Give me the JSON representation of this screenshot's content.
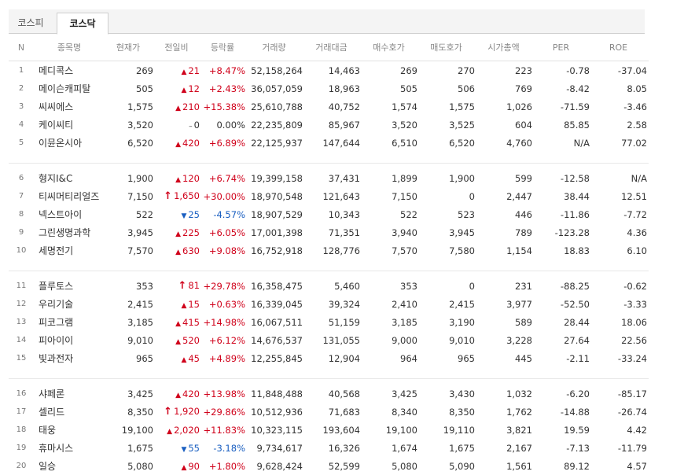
{
  "tabs": [
    {
      "label": "코스피"
    },
    {
      "label": "코스닥"
    }
  ],
  "columns": [
    "N",
    "종목명",
    "현재가",
    "전일비",
    "등락률",
    "거래량",
    "거래대금",
    "매수호가",
    "매도호가",
    "시가총액",
    "PER",
    "ROE"
  ],
  "groups": [
    [
      {
        "n": "1",
        "name": "메디콕스",
        "price": "269",
        "dir": "up",
        "change": "21",
        "rate": "+8.47%",
        "volume": "52,158,264",
        "amount": "14,463",
        "bid": "269",
        "ask": "270",
        "cap": "223",
        "per": "-0.78",
        "roe": "-37.04"
      },
      {
        "n": "2",
        "name": "메이슨캐피탈",
        "price": "505",
        "dir": "up",
        "change": "12",
        "rate": "+2.43%",
        "volume": "36,057,059",
        "amount": "18,963",
        "bid": "505",
        "ask": "506",
        "cap": "769",
        "per": "-8.42",
        "roe": "8.05"
      },
      {
        "n": "3",
        "name": "씨씨에스",
        "price": "1,575",
        "dir": "up",
        "change": "210",
        "rate": "+15.38%",
        "volume": "25,610,788",
        "amount": "40,752",
        "bid": "1,574",
        "ask": "1,575",
        "cap": "1,026",
        "per": "-71.59",
        "roe": "-3.46"
      },
      {
        "n": "4",
        "name": "케이씨티",
        "price": "3,520",
        "dir": "flat",
        "change": "0",
        "rate": "0.00%",
        "volume": "22,235,809",
        "amount": "85,967",
        "bid": "3,520",
        "ask": "3,525",
        "cap": "604",
        "per": "85.85",
        "roe": "2.58"
      },
      {
        "n": "5",
        "name": "이뮨온시아",
        "price": "6,520",
        "dir": "up",
        "change": "420",
        "rate": "+6.89%",
        "volume": "22,125,937",
        "amount": "147,644",
        "bid": "6,510",
        "ask": "6,520",
        "cap": "4,760",
        "per": "N/A",
        "roe": "77.02"
      }
    ],
    [
      {
        "n": "6",
        "name": "형지I&C",
        "price": "1,900",
        "dir": "up",
        "change": "120",
        "rate": "+6.74%",
        "volume": "19,399,158",
        "amount": "37,431",
        "bid": "1,899",
        "ask": "1,900",
        "cap": "599",
        "per": "-12.58",
        "roe": "N/A"
      },
      {
        "n": "7",
        "name": "티씨머티리얼즈",
        "price": "7,150",
        "dir": "upper",
        "change": "1,650",
        "rate": "+30.00%",
        "volume": "18,970,548",
        "amount": "121,643",
        "bid": "7,150",
        "ask": "0",
        "cap": "2,447",
        "per": "38.44",
        "roe": "12.51"
      },
      {
        "n": "8",
        "name": "넥스트아이",
        "price": "522",
        "dir": "down",
        "change": "25",
        "rate": "-4.57%",
        "volume": "18,907,529",
        "amount": "10,343",
        "bid": "522",
        "ask": "523",
        "cap": "446",
        "per": "-11.86",
        "roe": "-7.72"
      },
      {
        "n": "9",
        "name": "그린생명과학",
        "price": "3,945",
        "dir": "up",
        "change": "225",
        "rate": "+6.05%",
        "volume": "17,001,398",
        "amount": "71,351",
        "bid": "3,940",
        "ask": "3,945",
        "cap": "789",
        "per": "-123.28",
        "roe": "4.36"
      },
      {
        "n": "10",
        "name": "세명전기",
        "price": "7,570",
        "dir": "up",
        "change": "630",
        "rate": "+9.08%",
        "volume": "16,752,918",
        "amount": "128,776",
        "bid": "7,570",
        "ask": "7,580",
        "cap": "1,154",
        "per": "18.83",
        "roe": "6.10"
      }
    ],
    [
      {
        "n": "11",
        "name": "플루토스",
        "price": "353",
        "dir": "upper",
        "change": "81",
        "rate": "+29.78%",
        "volume": "16,358,475",
        "amount": "5,460",
        "bid": "353",
        "ask": "0",
        "cap": "231",
        "per": "-88.25",
        "roe": "-0.62"
      },
      {
        "n": "12",
        "name": "우리기술",
        "price": "2,415",
        "dir": "up",
        "change": "15",
        "rate": "+0.63%",
        "volume": "16,339,045",
        "amount": "39,324",
        "bid": "2,410",
        "ask": "2,415",
        "cap": "3,977",
        "per": "-52.50",
        "roe": "-3.33"
      },
      {
        "n": "13",
        "name": "피코그램",
        "price": "3,185",
        "dir": "up",
        "change": "415",
        "rate": "+14.98%",
        "volume": "16,067,511",
        "amount": "51,159",
        "bid": "3,185",
        "ask": "3,190",
        "cap": "589",
        "per": "28.44",
        "roe": "18.06"
      },
      {
        "n": "14",
        "name": "피아이이",
        "price": "9,010",
        "dir": "up",
        "change": "520",
        "rate": "+6.12%",
        "volume": "14,676,537",
        "amount": "131,055",
        "bid": "9,000",
        "ask": "9,010",
        "cap": "3,228",
        "per": "27.64",
        "roe": "22.56"
      },
      {
        "n": "15",
        "name": "빛과전자",
        "price": "965",
        "dir": "up",
        "change": "45",
        "rate": "+4.89%",
        "volume": "12,255,845",
        "amount": "12,904",
        "bid": "964",
        "ask": "965",
        "cap": "445",
        "per": "-2.11",
        "roe": "-33.24"
      }
    ],
    [
      {
        "n": "16",
        "name": "샤페론",
        "price": "3,425",
        "dir": "up",
        "change": "420",
        "rate": "+13.98%",
        "volume": "11,848,488",
        "amount": "40,568",
        "bid": "3,425",
        "ask": "3,430",
        "cap": "1,032",
        "per": "-6.20",
        "roe": "-85.17"
      },
      {
        "n": "17",
        "name": "셀리드",
        "price": "8,350",
        "dir": "upper",
        "change": "1,920",
        "rate": "+29.86%",
        "volume": "10,512,936",
        "amount": "71,683",
        "bid": "8,340",
        "ask": "8,350",
        "cap": "1,762",
        "per": "-14.88",
        "roe": "-26.74"
      },
      {
        "n": "18",
        "name": "태웅",
        "price": "19,100",
        "dir": "up",
        "change": "2,020",
        "rate": "+11.83%",
        "volume": "10,323,115",
        "amount": "193,604",
        "bid": "19,100",
        "ask": "19,110",
        "cap": "3,821",
        "per": "19.59",
        "roe": "4.42"
      },
      {
        "n": "19",
        "name": "휴마시스",
        "price": "1,675",
        "dir": "down",
        "change": "55",
        "rate": "-3.18%",
        "volume": "9,734,617",
        "amount": "16,326",
        "bid": "1,674",
        "ask": "1,675",
        "cap": "2,167",
        "per": "-7.13",
        "roe": "-11.79"
      },
      {
        "n": "20",
        "name": "일승",
        "price": "5,080",
        "dir": "up",
        "change": "90",
        "rate": "+1.80%",
        "volume": "9,628,424",
        "amount": "52,599",
        "bid": "5,080",
        "ask": "5,090",
        "cap": "1,561",
        "per": "89.12",
        "roe": "4.57"
      }
    ]
  ],
  "icons": {
    "up": "triangle-up-icon",
    "upper": "upper-limit-arrow-icon",
    "down": "triangle-down-icon",
    "flat": "flat-dash-icon"
  },
  "colors": {
    "up": "#d0021b",
    "down": "#1a5fc1",
    "flat": "#333333"
  }
}
